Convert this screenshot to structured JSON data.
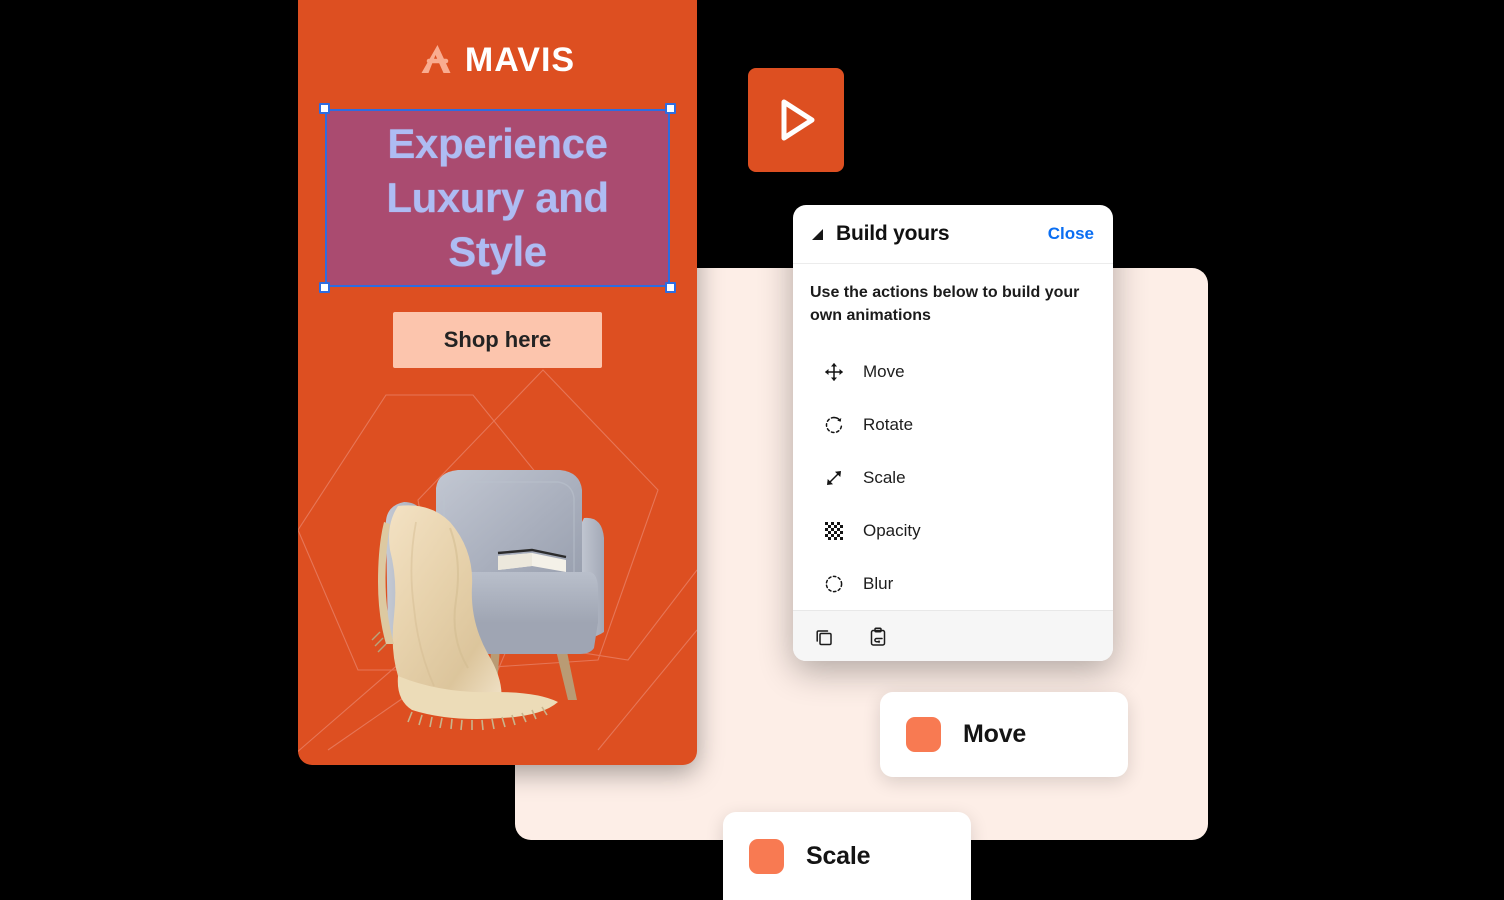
{
  "poster": {
    "brand_name": "MAVIS",
    "brand_mark_icon": "mavis-a-logomark",
    "headline": "Experience\nLuxury and\nStyle",
    "cta_label": "Shop here",
    "artwork_alt": "grey-armchair-with-beige-throw",
    "background_color": "#dd4f21",
    "cta_color": "#fcc5ad",
    "headline_text_color": "#aebcf3",
    "selection_overlay_color": "#8b48a2",
    "selection_border_color": "#2e6ce0"
  },
  "play_button": {
    "icon": "play-triangle-icon",
    "background_color": "#dd4f21"
  },
  "background_panel": {
    "color": "#fdeee7"
  },
  "build_panel": {
    "back_icon": "back-triangle-icon",
    "title": "Build yours",
    "close_label": "Close",
    "close_color": "#0a6ef2",
    "description": "Use the actions below to build your own animations",
    "actions": [
      {
        "icon": "move-arrows-icon",
        "label": "Move"
      },
      {
        "icon": "rotate-circle-icon",
        "label": "Rotate"
      },
      {
        "icon": "scale-diagonal-icon",
        "label": "Scale"
      },
      {
        "icon": "opacity-checker-icon",
        "label": "Opacity"
      },
      {
        "icon": "blur-dashed-circle-icon",
        "label": "Blur"
      }
    ],
    "footer": [
      {
        "icon": "copy-icon",
        "label": "Copy"
      },
      {
        "icon": "paste-icon",
        "label": "Paste"
      }
    ]
  },
  "action_cards": [
    {
      "label": "Move",
      "swatch_color": "#f87a52"
    },
    {
      "label": "Scale",
      "swatch_color": "#f87a52"
    }
  ]
}
